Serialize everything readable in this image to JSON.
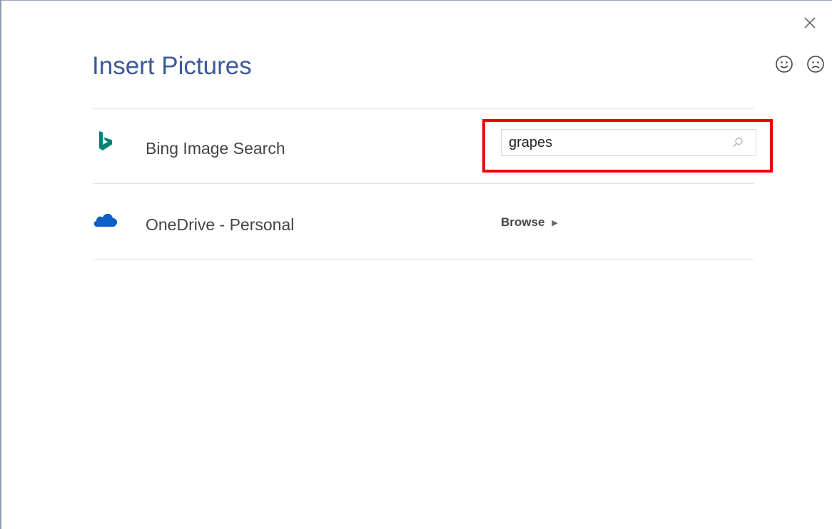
{
  "dialog": {
    "title": "Insert Pictures",
    "close_glyph": "×",
    "feedback": {
      "smile_icon": "smile-icon",
      "frown_icon": "frown-icon"
    }
  },
  "sources": {
    "bing": {
      "label": "Bing Image Search",
      "icon": "bing-icon",
      "search_value": "grapes",
      "search_placeholder": "",
      "search_icon": "search-icon",
      "brand_color": "#008373"
    },
    "onedrive": {
      "label": "OneDrive - Personal",
      "icon": "onedrive-cloud-icon",
      "browse_label": "Browse",
      "browse_arrow": "▶",
      "brand_color": "#0d5ec9"
    }
  },
  "annotation": {
    "highlight_color": "#ee0000"
  }
}
